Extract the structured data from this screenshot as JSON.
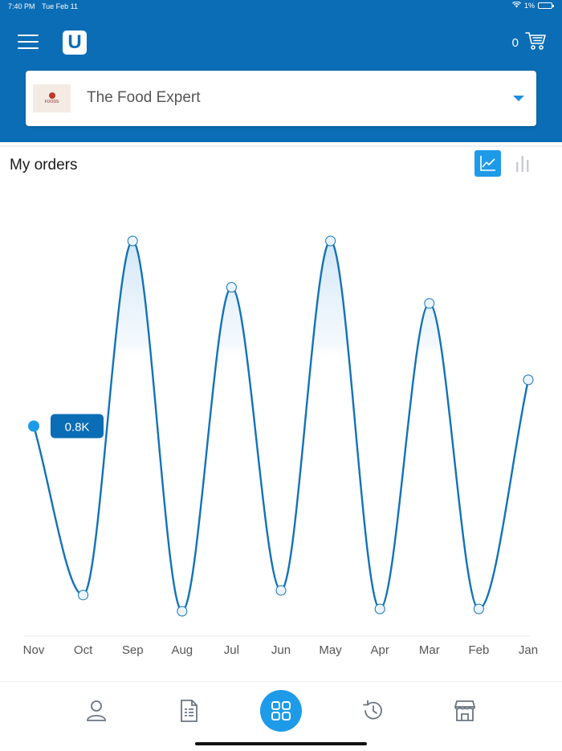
{
  "status_bar": {
    "time": "7:40 PM",
    "date": "Tue Feb 11",
    "battery": "1%"
  },
  "header": {
    "app_logo": "U",
    "cart_count": "0",
    "store_selector": {
      "selected_store": "The Food Expert"
    }
  },
  "section": {
    "title": "My orders"
  },
  "colors": {
    "brand_blue": "#0b6db5",
    "accent_blue": "#1e9be8",
    "line": "#1272b8"
  },
  "chart_data": {
    "type": "line",
    "categories": [
      "Nov",
      "Oct",
      "Sep",
      "Aug",
      "Jul",
      "Jun",
      "May",
      "Apr",
      "Mar",
      "Feb",
      "Jan"
    ],
    "values": [
      0.8,
      0.07,
      1.6,
      0.0,
      1.4,
      0.09,
      1.6,
      0.01,
      1.33,
      0.01,
      1.0
    ],
    "ylim": [
      0,
      1.6
    ],
    "tooltip": {
      "index": 0,
      "label": "0.8K"
    },
    "grid": false
  },
  "bottom_nav": {
    "items": [
      "profile-icon",
      "invoice-icon",
      "dashboard-icon",
      "history-icon",
      "store-icon"
    ]
  }
}
